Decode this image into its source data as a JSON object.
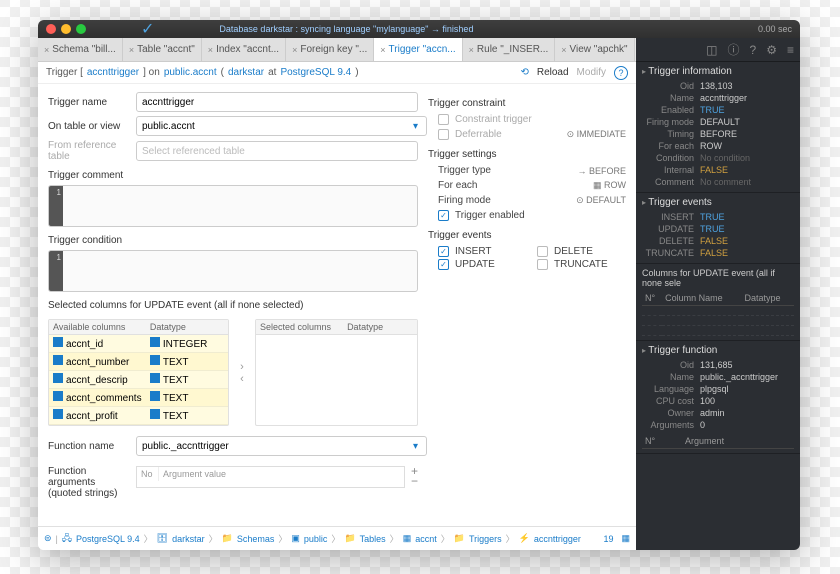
{
  "status": {
    "msg": "Database darkstar : syncing language \"mylanguage\" → finished",
    "time": "0.00 sec"
  },
  "tabs": [
    {
      "label": "Schema \"bill..."
    },
    {
      "label": "Table \"accnt\""
    },
    {
      "label": "Index \"accnt..."
    },
    {
      "label": "Foreign key \"..."
    },
    {
      "label": "Trigger \"accn...",
      "active": true
    },
    {
      "label": "Rule \"_INSER..."
    },
    {
      "label": "View \"apchk\""
    }
  ],
  "crumb": {
    "pre": "Trigger [",
    "name": "accnttrigger",
    "mid": "] on",
    "table": "public.accnt",
    "open": "(",
    "db": "darkstar",
    "at": "at",
    "server": "PostgreSQL 9.4",
    "close": ")",
    "reload": "Reload",
    "modify": "Modify"
  },
  "form": {
    "trigger_name": {
      "label": "Trigger name",
      "value": "accnttrigger"
    },
    "on_table": {
      "label": "On table or view",
      "value": "public.accnt"
    },
    "ref_table": {
      "label": "From reference table",
      "placeholder": "Select referenced table"
    },
    "comment_label": "Trigger comment",
    "condition_label": "Trigger condition",
    "gutter_line": "1",
    "sel_cols_label": "Selected columns for UPDATE event (all if none selected)",
    "avail_h1": "Available columns",
    "avail_h2": "Datatype",
    "sel_h1": "Selected columns",
    "sel_h2": "Datatype",
    "cols": [
      {
        "name": "accnt_id",
        "type": "INTEGER"
      },
      {
        "name": "accnt_number",
        "type": "TEXT"
      },
      {
        "name": "accnt_descrip",
        "type": "TEXT"
      },
      {
        "name": "accnt_comments",
        "type": "TEXT"
      },
      {
        "name": "accnt_profit",
        "type": "TEXT"
      }
    ],
    "fn_name": {
      "label": "Function name",
      "value": "public._accnttrigger"
    },
    "fn_args": {
      "label": "Function arguments (quoted strings)",
      "no": "No",
      "av": "Argument value"
    }
  },
  "rpanel": {
    "constraint": {
      "title": "Trigger constraint",
      "constraint": "Constraint trigger",
      "deferrable": "Deferrable",
      "immediate": "IMMEDIATE"
    },
    "settings": {
      "title": "Trigger settings",
      "type": {
        "label": "Trigger type",
        "value": "→ BEFORE"
      },
      "each": {
        "label": "For each",
        "value": "ROW"
      },
      "mode": {
        "label": "Firing mode",
        "value": "DEFAULT"
      },
      "enabled": "Trigger enabled"
    },
    "events": {
      "title": "Trigger events",
      "insert": "INSERT",
      "delete": "DELETE",
      "update": "UPDATE",
      "truncate": "TRUNCATE"
    }
  },
  "footer": {
    "items": [
      "PostgreSQL 9.4",
      "darkstar",
      "Schemas",
      "public",
      "Tables",
      "accnt",
      "Triggers",
      "accnttrigger"
    ],
    "count": "19"
  },
  "side": {
    "info": {
      "title": "Trigger information",
      "rows": [
        {
          "l": "Oid",
          "v": "138,103"
        },
        {
          "l": "Name",
          "v": "accnttrigger"
        },
        {
          "l": "Enabled",
          "v": "TRUE",
          "cls": "true"
        },
        {
          "l": "Firing mode",
          "v": "DEFAULT"
        },
        {
          "l": "Timing",
          "v": "BEFORE"
        },
        {
          "l": "For each",
          "v": "ROW"
        },
        {
          "l": "Condition",
          "v": "No condition",
          "cls": "gray"
        },
        {
          "l": "Internal",
          "v": "FALSE",
          "cls": "false"
        },
        {
          "l": "Comment",
          "v": "No comment",
          "cls": "gray"
        }
      ]
    },
    "events": {
      "title": "Trigger events",
      "rows": [
        {
          "l": "INSERT",
          "v": "TRUE",
          "cls": "true"
        },
        {
          "l": "UPDATE",
          "v": "TRUE",
          "cls": "true"
        },
        {
          "l": "DELETE",
          "v": "FALSE",
          "cls": "false"
        },
        {
          "l": "TRUNCATE",
          "v": "FALSE",
          "cls": "false"
        }
      ]
    },
    "updcols": {
      "title": "Columns for UPDATE event (all if none sele",
      "h1": "N°",
      "h2": "Column Name",
      "h3": "Datatype"
    },
    "fn": {
      "title": "Trigger function",
      "rows": [
        {
          "l": "Oid",
          "v": "131,685"
        },
        {
          "l": "Name",
          "v": "public._accnttrigger"
        },
        {
          "l": "Language",
          "v": "plpgsql"
        },
        {
          "l": "CPU cost",
          "v": "100"
        },
        {
          "l": "Owner",
          "v": "admin"
        },
        {
          "l": "Arguments",
          "v": "0"
        }
      ],
      "arg_h1": "N°",
      "arg_h2": "Argument"
    }
  }
}
